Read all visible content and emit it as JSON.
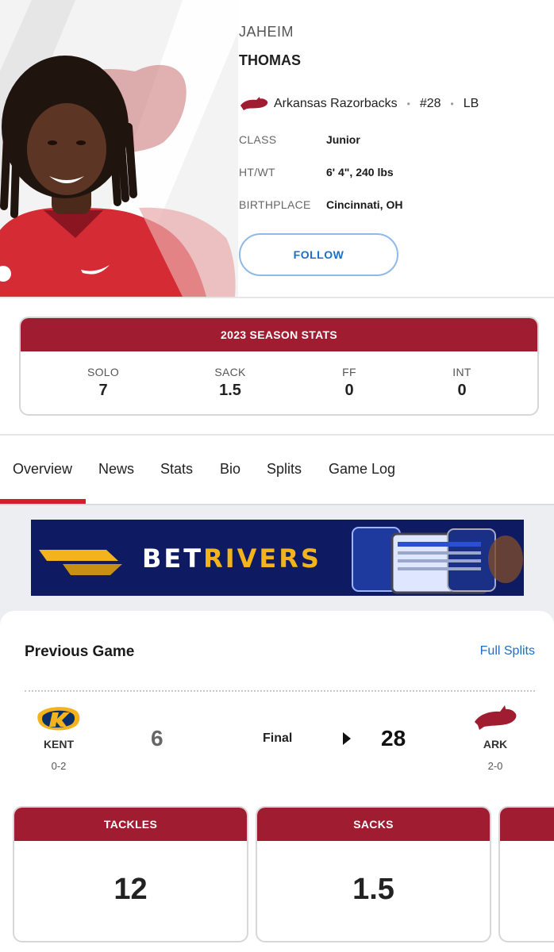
{
  "player": {
    "first_name": "JAHEIM",
    "last_name": "THOMAS",
    "team": "Arkansas Razorbacks",
    "number": "#28",
    "position": "LB",
    "info": [
      {
        "label": "CLASS",
        "value": "Junior"
      },
      {
        "label": "HT/WT",
        "value": "6' 4\", 240 lbs"
      },
      {
        "label": "BIRTHPLACE",
        "value": "Cincinnati, OH"
      }
    ],
    "follow_label": "FOLLOW"
  },
  "season_stats": {
    "title": "2023 SEASON STATS",
    "stats": [
      {
        "label": "SOLO",
        "value": "7"
      },
      {
        "label": "SACK",
        "value": "1.5"
      },
      {
        "label": "FF",
        "value": "0"
      },
      {
        "label": "INT",
        "value": "0"
      }
    ]
  },
  "tabs": [
    "Overview",
    "News",
    "Stats",
    "Bio",
    "Splits",
    "Game Log"
  ],
  "active_tab": "Overview",
  "ad": {
    "brand_white": "BET",
    "brand_gold": "RIVERS"
  },
  "previous_game": {
    "title": "Previous Game",
    "full_splits_label": "Full Splits",
    "away": {
      "abbr": "KENT",
      "record": "0-2",
      "score": "6"
    },
    "home": {
      "abbr": "ARK",
      "record": "2-0",
      "score": "28"
    },
    "status": "Final",
    "stat_cards": [
      {
        "label": "TACKLES",
        "value": "12"
      },
      {
        "label": "SACKS",
        "value": "1.5"
      }
    ]
  },
  "colors": {
    "razorback_red": "#a01c30",
    "accent_red": "#d11f2e",
    "link_blue": "#1c6fc4",
    "ad_navy": "#0e1b63",
    "ad_gold": "#f2b31d"
  }
}
